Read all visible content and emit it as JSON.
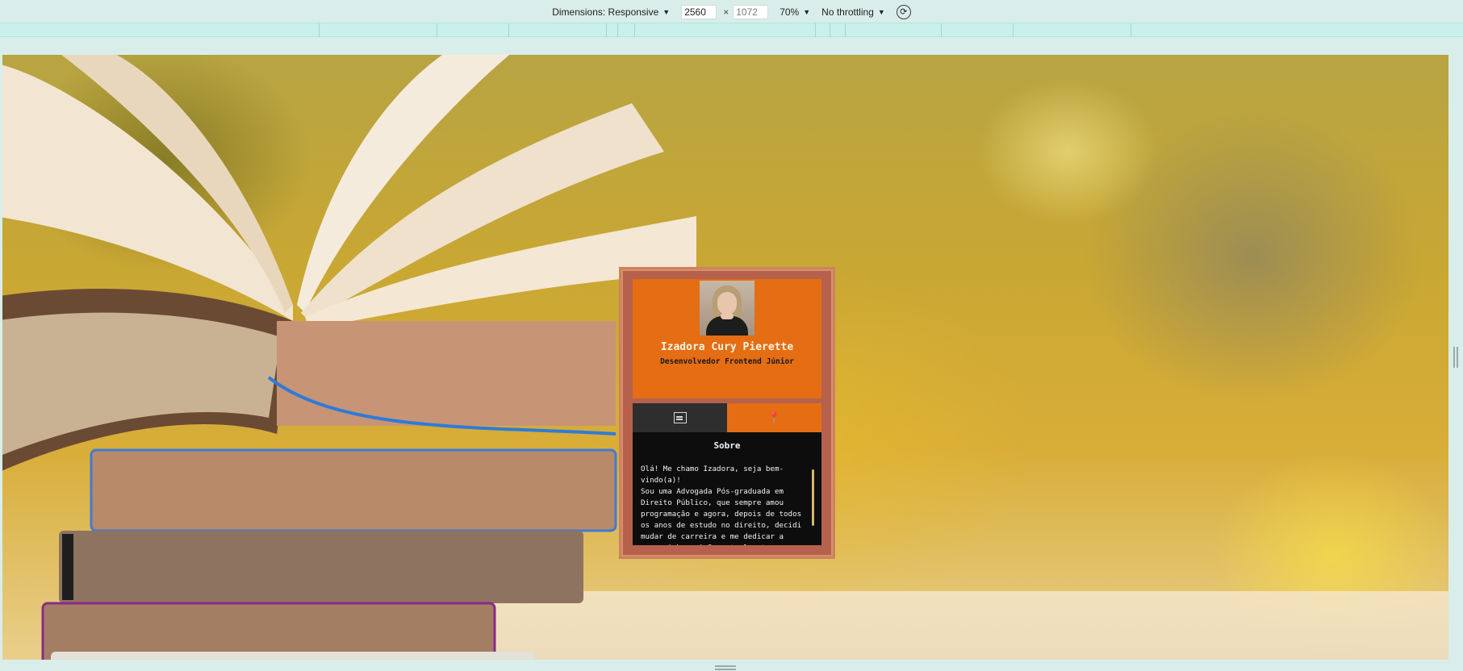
{
  "toolbar": {
    "dimensions_label": "Dimensions: Responsive",
    "width_value": "2560",
    "height_value": "1072",
    "times_sign": "×",
    "zoom_label": "70%",
    "throttling_label": "No throttling",
    "caret": "▼",
    "rotate_icon": "rotate-icon"
  },
  "card": {
    "name": "Izadora Cury Pierette",
    "role": "Desenvolvedor Frontend Júnior",
    "tabs": [
      {
        "icon": "document-icon",
        "active": true
      },
      {
        "icon": "pin-icon",
        "active": false
      }
    ],
    "section_title": "Sobre",
    "about_text": "Olá! Me chamo Izadora, seja bem-\nvindo(a)!\nSou uma Advogada Pós-graduada em\nDireito Público, que sempre amou\nprogramação e agora, depois de todos\nos anos de estudo no direito, decidi\nmudar de carreira e me dedicar a\nessa minha paixão, atualmente\ncomecei a colocar esse sonho em",
    "colors": {
      "header": "#e56d13",
      "frame": "#b5614c",
      "body": "#0d0d0d"
    }
  }
}
